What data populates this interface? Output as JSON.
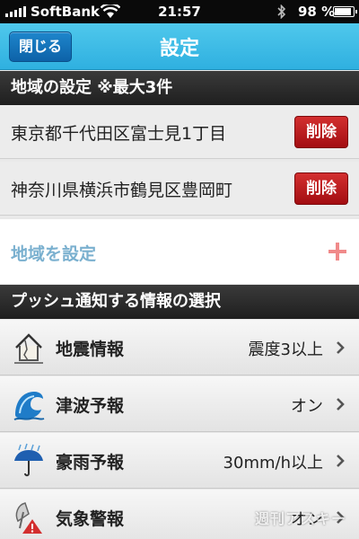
{
  "status_bar": {
    "carrier": "SoftBank",
    "time": "21:57",
    "battery": "98 %",
    "icons": [
      "signal-icon",
      "wifi-icon",
      "bluetooth-icon",
      "battery-icon"
    ]
  },
  "nav": {
    "title": "設定",
    "close_label": "閉じる"
  },
  "region_section": {
    "header": "地域の設定 ※最大3件",
    "regions": [
      {
        "label": "東京都千代田区富士見1丁目",
        "delete_label": "削除"
      },
      {
        "label": "神奈川県横浜市鶴見区豊岡町",
        "delete_label": "削除"
      }
    ],
    "add_label": "地域を設定"
  },
  "push_section": {
    "header": "プッシュ通知する情報の選択",
    "items": [
      {
        "label": "地震情報",
        "value": "震度3以上",
        "icon": "earthquake-house-icon"
      },
      {
        "label": "津波予報",
        "value": "オン",
        "icon": "tsunami-wave-icon"
      },
      {
        "label": "豪雨予報",
        "value": "30mm/h以上",
        "icon": "umbrella-rain-icon"
      },
      {
        "label": "気象警報",
        "value": "オン",
        "icon": "weather-warning-icon"
      }
    ]
  },
  "watermark": "週刊アスキー",
  "colors": {
    "nav_blue": "#2fb0e0",
    "delete_red": "#c62828",
    "add_text": "#7ab0cf",
    "plus": "#f08a8a"
  }
}
